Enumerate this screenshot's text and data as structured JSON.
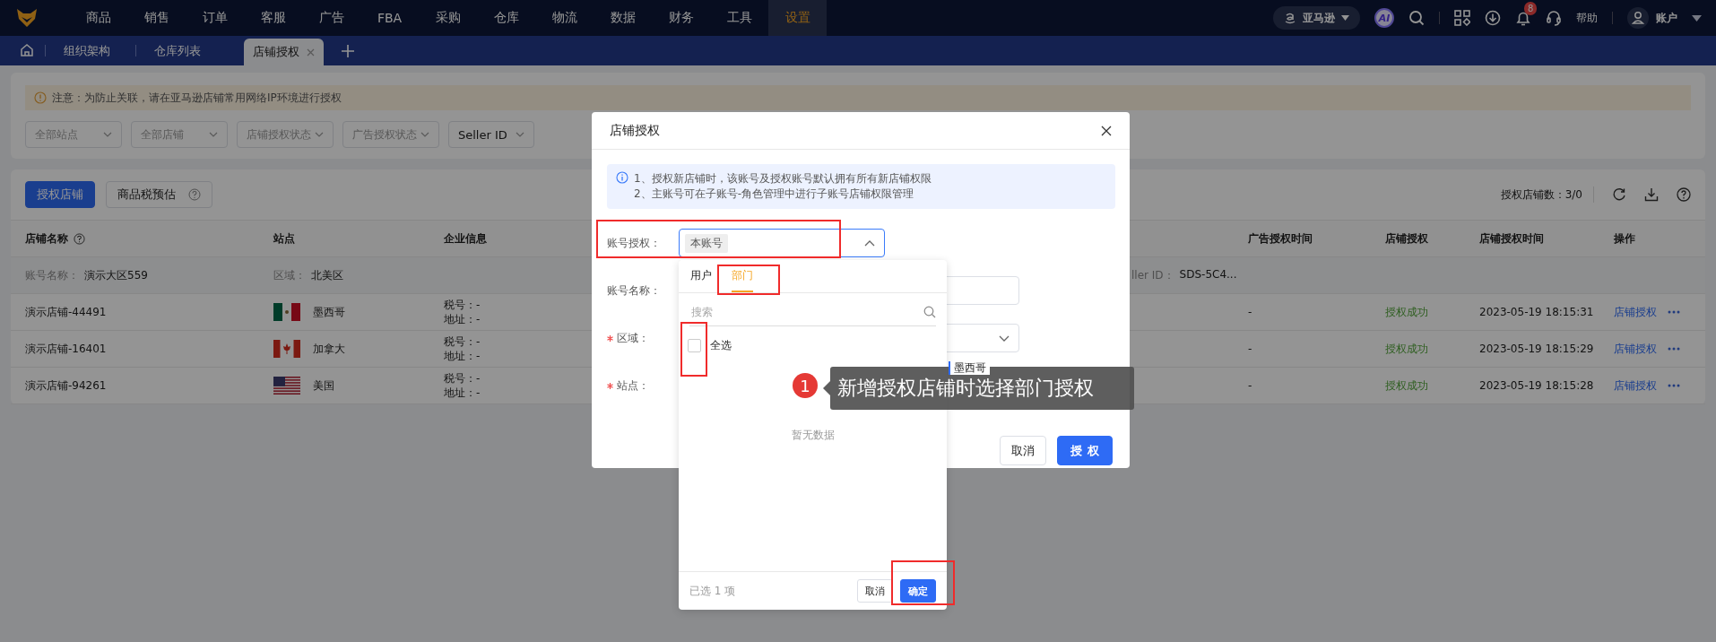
{
  "nav": {
    "menu": [
      {
        "label": "商品",
        "selected": false
      },
      {
        "label": "销售",
        "selected": false
      },
      {
        "label": "订单",
        "selected": false
      },
      {
        "label": "客服",
        "selected": false
      },
      {
        "label": "广告",
        "selected": false
      },
      {
        "label": "FBA",
        "selected": false
      },
      {
        "label": "采购",
        "selected": false
      },
      {
        "label": "仓库",
        "selected": false
      },
      {
        "label": "物流",
        "selected": false
      },
      {
        "label": "数据",
        "selected": false
      },
      {
        "label": "财务",
        "selected": false
      },
      {
        "label": "工具",
        "selected": false
      },
      {
        "label": "设置",
        "selected": true
      }
    ],
    "marketplace": "亚马逊",
    "ai": "AI",
    "notification_count": "8",
    "help": "帮助",
    "account": "账户"
  },
  "tabs": [
    {
      "label": "组织架构",
      "selected": false
    },
    {
      "label": "仓库列表",
      "selected": false
    },
    {
      "label": "店铺授权",
      "selected": true
    }
  ],
  "notice": "注意：为防止关联，请在亚马逊店铺常用网络IP环境进行授权",
  "filters": [
    {
      "placeholder": "全部站点"
    },
    {
      "placeholder": "全部店铺"
    },
    {
      "placeholder": "店铺授权状态"
    },
    {
      "placeholder": "广告授权状态"
    },
    {
      "value": "Seller ID"
    }
  ],
  "toolbar": {
    "primary_button": "授权店铺",
    "secondary_button": "商品税预估",
    "count": "授权店铺数：3/0"
  },
  "table": {
    "columns": [
      "店铺名称",
      "站点",
      "企业信息",
      "广告授权时间",
      "店铺授权",
      "店铺授权时间",
      "操作"
    ],
    "group": {
      "account_label": "账号名称：",
      "account": "演示大区559",
      "region_label": "区域：",
      "region": "北美区",
      "seller_label": "ller ID：",
      "seller": "SDS-5C4..."
    },
    "rows": [
      {
        "store": "演示店铺-44491",
        "kind": "mx",
        "site": "墨西哥",
        "tax": "税号：-",
        "address": "地址：-",
        "ad_time": "-",
        "status": "授权成功",
        "auth_time": "2023-05-19 18:15:31",
        "action": "店铺授权"
      },
      {
        "store": "演示店铺-16401",
        "kind": "ca",
        "site": "加拿大",
        "tax": "税号：-",
        "address": "地址：-",
        "ad_time": "-",
        "status": "授权成功",
        "auth_time": "2023-05-19 18:15:29",
        "action": "店铺授权"
      },
      {
        "store": "演示店铺-94261",
        "kind": "us",
        "site": "美国",
        "tax": "税号：-",
        "address": "地址：-",
        "ad_time": "-",
        "status": "授权成功",
        "auth_time": "2023-05-19 18:15:28",
        "action": "店铺授权"
      }
    ]
  },
  "modal": {
    "title": "店铺授权",
    "info": [
      "1、授权新店铺时，该账号及授权账号默认拥有所有新店铺权限",
      "2、主账号可在子账号-角色管理中进行子账号店铺权限管理"
    ],
    "fields": [
      {
        "label": "账号授权：",
        "required": false,
        "kind": "tags",
        "tags": [
          "本账号"
        ]
      },
      {
        "label": "账号名称：",
        "required": false,
        "kind": "input"
      },
      {
        "label": "区域：",
        "required": true,
        "kind": "select"
      },
      {
        "label": "站点：",
        "required": true,
        "kind": "sites",
        "value": "墨西哥"
      }
    ],
    "cancel": "取消",
    "confirm": "授权"
  },
  "dropdown": {
    "tabs": [
      {
        "label": "用户",
        "selected": false
      },
      {
        "label": "部门",
        "selected": true
      }
    ],
    "search": {
      "placeholder": "搜索"
    },
    "select_all": {
      "label": "全选",
      "checked": false
    },
    "empty": "暂无数据",
    "selected_count": "已选 1 项",
    "cancel": "取消",
    "confirm": "确定"
  },
  "callout": {
    "number": "1",
    "text": "新增授权店铺时选择部门授权"
  }
}
